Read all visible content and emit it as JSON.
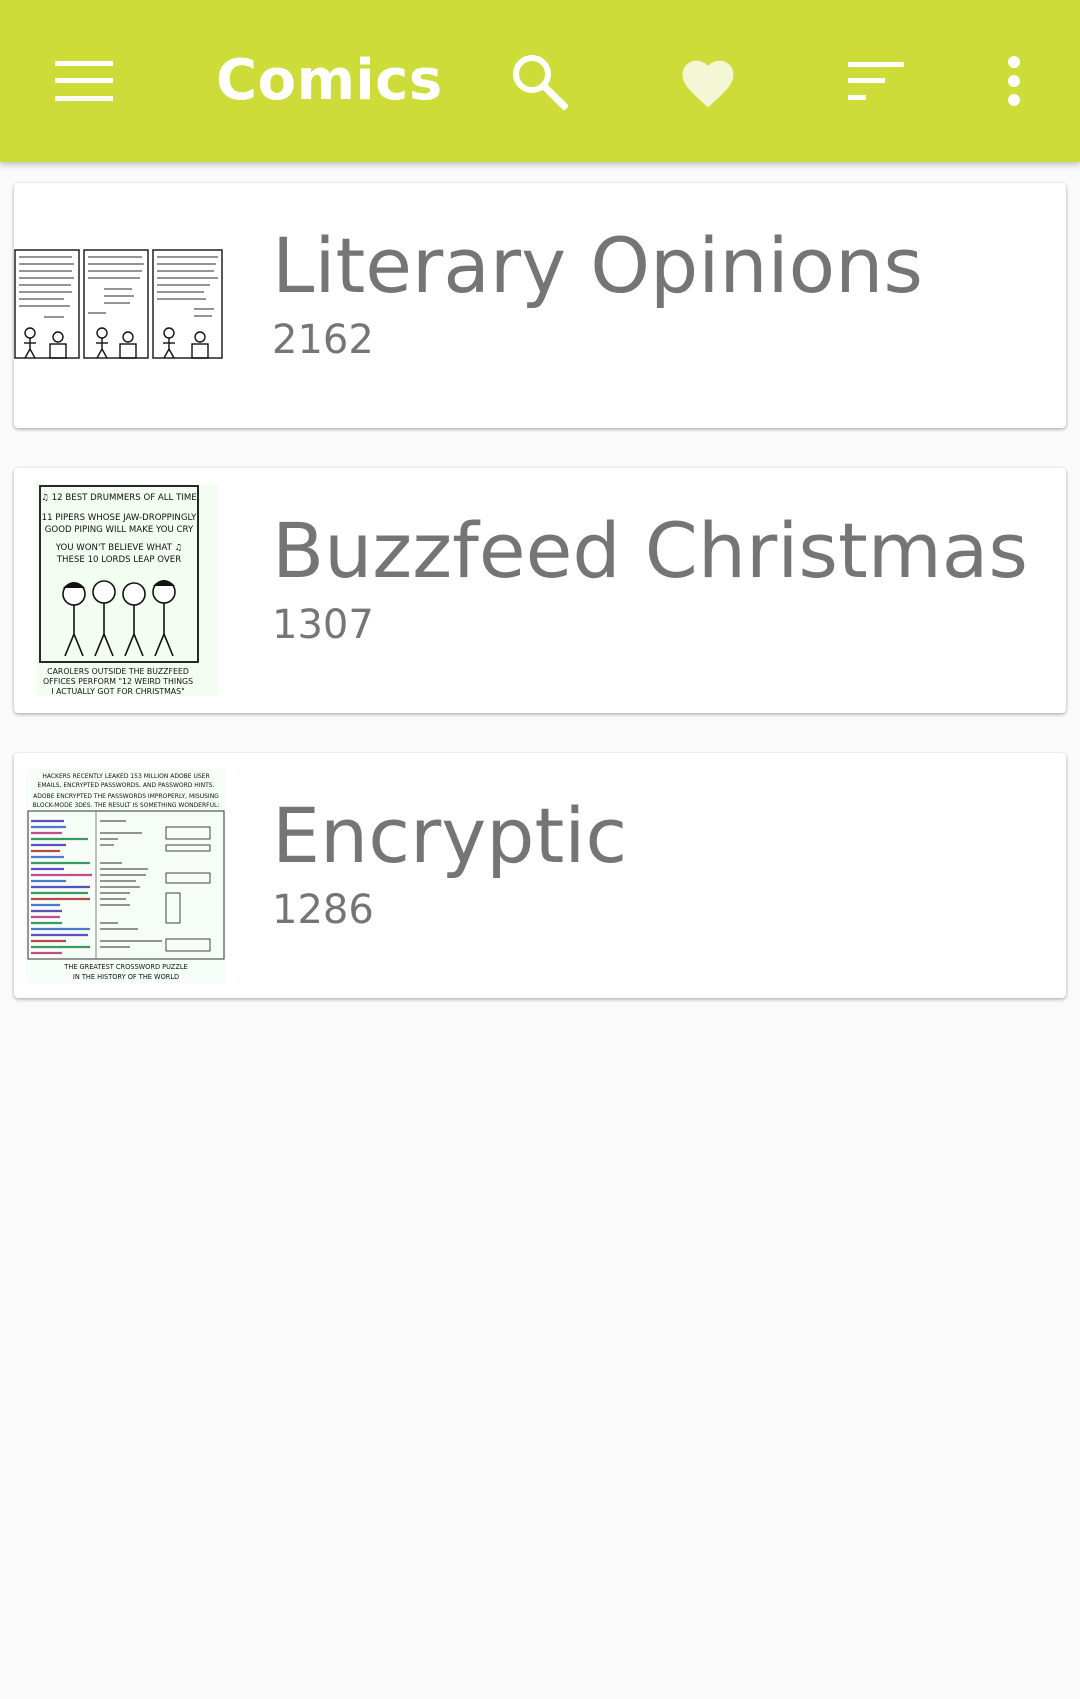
{
  "toolbar": {
    "title": "Comics",
    "background": "#cddc39",
    "icons": {
      "menu": "menu-icon",
      "search": "search-icon",
      "favorites": "heart-icon",
      "sort": "sort-icon",
      "more": "more-vert-icon"
    }
  },
  "comics": [
    {
      "title": "Literary Opinions",
      "number": "2162",
      "thumbnail": "three-panel-stick-figure-comic"
    },
    {
      "title": "Buzzfeed Christmas",
      "number": "1307",
      "thumbnail": "carolers-single-panel-comic"
    },
    {
      "title": "Encryptic",
      "number": "1286",
      "thumbnail": "crossword-table-comic"
    }
  ],
  "thumbnail_text": {
    "buzzfeed": {
      "line1": "♫ 12 BEST DRUMMERS OF ALL TIME",
      "line2": "11 PIPERS WHOSE JAW-DROPPINGLY",
      "line3": "GOOD PIPING WILL MAKE YOU CRY",
      "line4": "YOU WON'T BELIEVE WHAT ♫",
      "line5": "THESE 10 LORDS LEAP OVER",
      "caption1": "CAROLERS OUTSIDE THE BUZZFEED",
      "caption2": "OFFICES PERFORM \"12 WEIRD THINGS",
      "caption3": "I ACTUALLY GOT FOR CHRISTMAS\""
    },
    "encryptic": {
      "line1": "HACKERS RECENTLY LEAKED 153 MILLION ADOBE USER",
      "line2": "EMAILS, ENCRYPTED PASSWORDS, AND PASSWORD HINTS.",
      "line3": "ADOBE ENCRYPTED THE PASSWORDS IMPROPERLY, MISUSING",
      "line4": "BLOCK-MODE 3DES. THE RESULT IS SOMETHING WONDERFUL:",
      "caption1": "THE GREATEST CROSSWORD PUZZLE",
      "caption2": "IN THE HISTORY OF THE WORLD"
    }
  }
}
